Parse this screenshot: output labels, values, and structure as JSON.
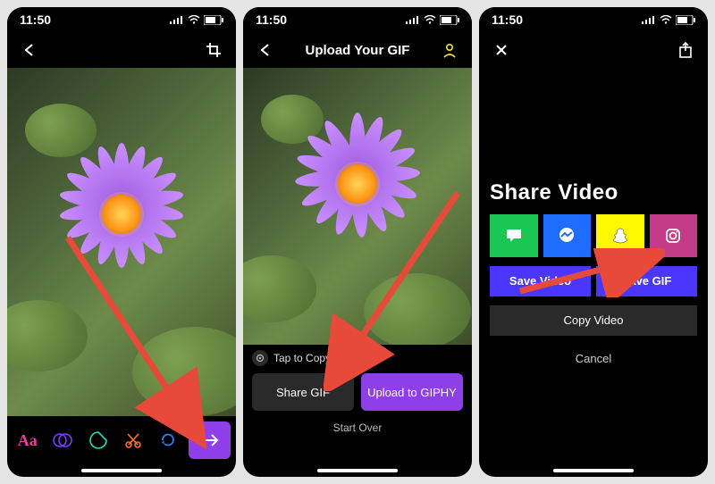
{
  "status": {
    "time": "11:50"
  },
  "screen1": {
    "tools": {
      "text_label": "Aa"
    }
  },
  "screen2": {
    "title": "Upload Your GIF",
    "tap_hint": "Tap to Copy GIF",
    "share_btn": "Share GIF",
    "upload_btn": "Upload to GIPHY",
    "start_over": "Start Over"
  },
  "screen3": {
    "title": "Share Video",
    "save_video": "Save Video",
    "save_gif": "Save GIF",
    "copy_video": "Copy Video",
    "cancel": "Cancel"
  }
}
